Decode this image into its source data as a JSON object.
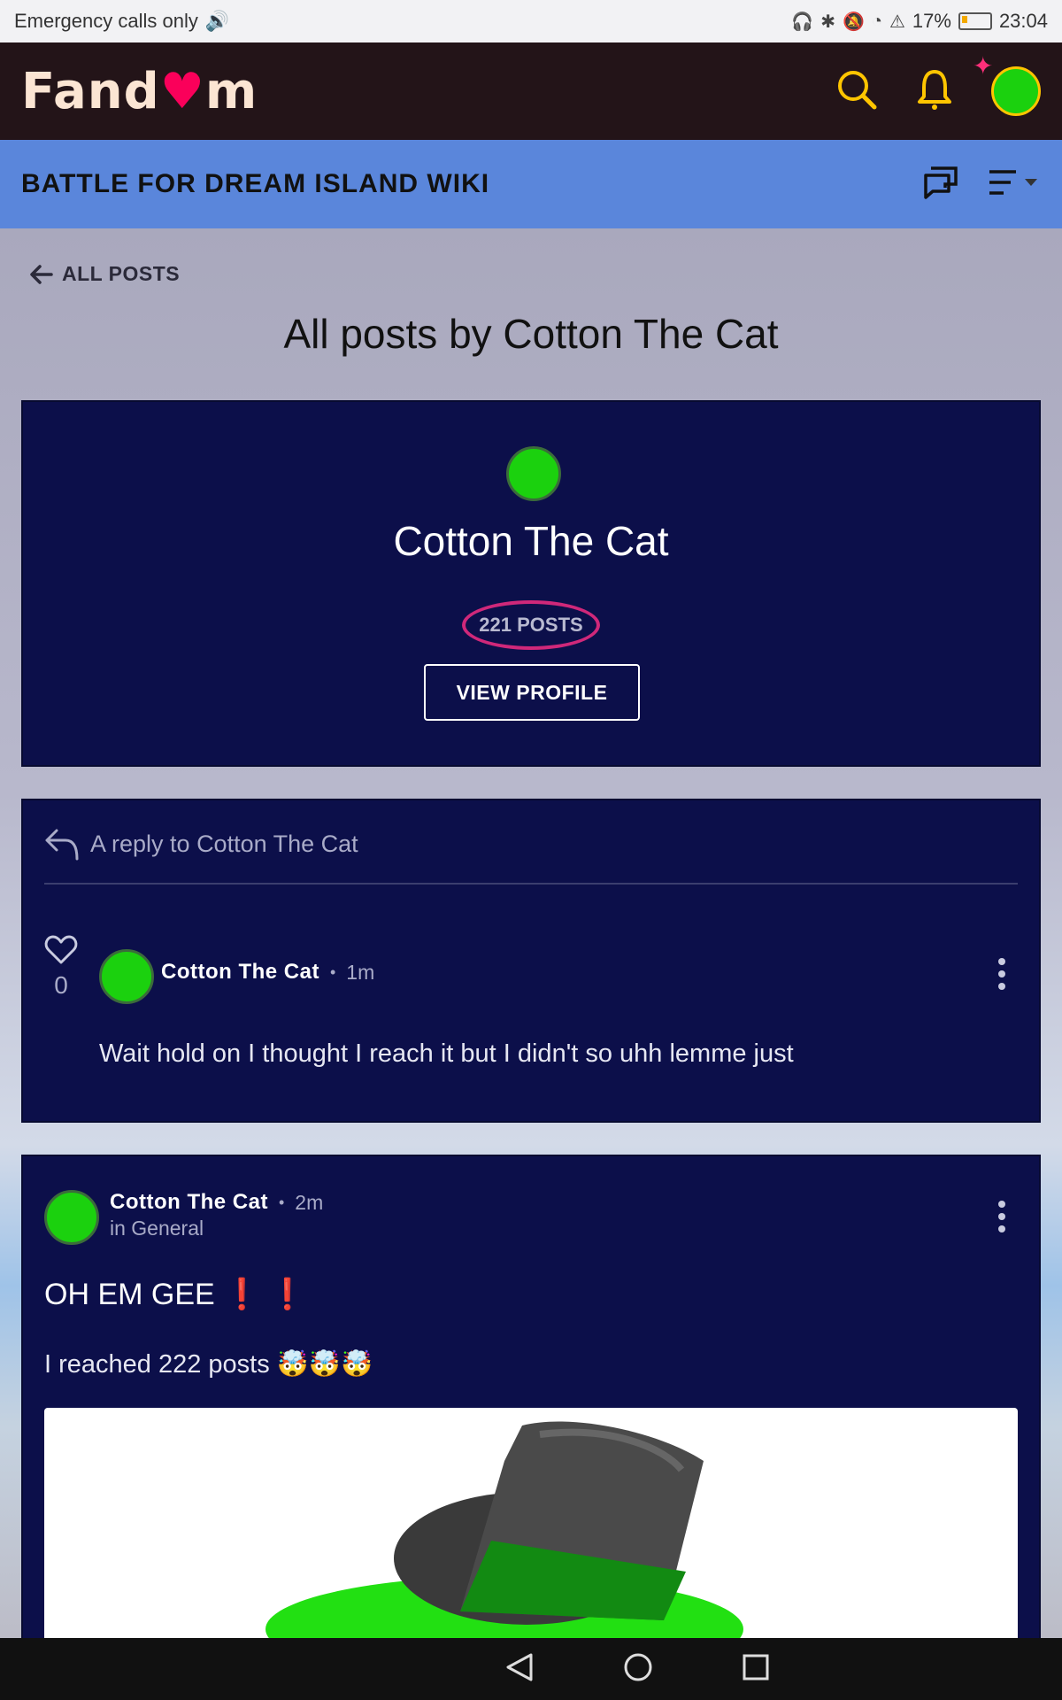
{
  "status_bar": {
    "left_text": "Emergency calls only",
    "battery": "17%",
    "time": "23:04"
  },
  "fandom": {
    "logo_text_start": "Fand",
    "logo_text_end": "m"
  },
  "wiki": {
    "title": "BATTLE FOR DREAM ISLAND WIKI"
  },
  "page": {
    "back_label": "ALL POSTS",
    "title": "All posts by Cotton The Cat"
  },
  "profile": {
    "name": "Cotton The Cat",
    "posts_count": "221 POSTS",
    "button_label": "VIEW PROFILE"
  },
  "reply_post": {
    "header": "A reply to Cotton The Cat",
    "likes": "0",
    "author": "Cotton The Cat",
    "time": "1m",
    "text": "Wait hold on I thought I reach it but I didn't so uhh lemme just"
  },
  "post": {
    "author": "Cotton The Cat",
    "time": "2m",
    "category": "in General",
    "title": "OH EM GEE",
    "title_marks": "❗ ❗",
    "body": "I reached 222 posts",
    "body_emoji": "🤯🤯🤯"
  },
  "colors": {
    "fandom_bar": "#231418",
    "wiki_bar": "#5a86db",
    "card_bg": "#0c0f4a",
    "highlight_circle": "#d0287a",
    "accent_yellow": "#ffc500"
  },
  "icons": [
    "search-icon",
    "bell-icon",
    "chat-icon",
    "menu-icon",
    "back-arrow-icon",
    "reply-icon",
    "heart-icon",
    "more-vertical-icon"
  ]
}
